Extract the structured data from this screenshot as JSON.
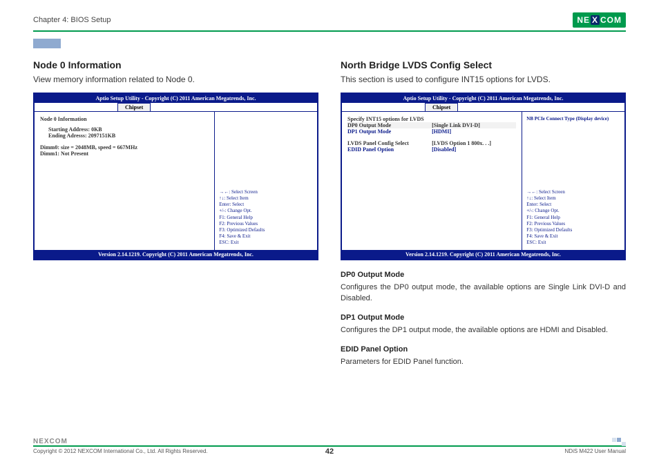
{
  "header": {
    "chapter": "Chapter 4: BIOS Setup",
    "brand_pre": "NE",
    "brand_mid": "X",
    "brand_post": "COM"
  },
  "left": {
    "heading": "Node 0 Information",
    "lead": "View memory information related to Node 0.",
    "bios": {
      "title": "Aptio Setup Utility - Copyright (C) 2011 American Megatrends, Inc.",
      "tab": "Chipset",
      "lines": {
        "l1": "Node 0 Information",
        "l2": "Starting Address: 0KB",
        "l3": "Ending Adresss: 2097151KB",
        "l4": "Dimm0: size = 2048MB, speed = 667MHz",
        "l5": "Dimm1: Not Present"
      },
      "help_top": "",
      "footer": "Version 2.14.1219. Copyright (C) 2011 American Megatrends, Inc."
    }
  },
  "right": {
    "heading": "North Bridge LVDS Config Select",
    "lead": "This section is used to configure INT15 options for LVDS.",
    "bios": {
      "title": "Aptio Setup Utility - Copyright (C) 2011 American Megatrends, Inc.",
      "tab": "Chipset",
      "rows": {
        "r0l": "Specify INT15 options for LVDS",
        "r1l": "DP0 Output Mode",
        "r1v": "[Single Link DVI-D]",
        "r2l": "DP1 Output Mode",
        "r2v": "[HDMI]",
        "r3l": "LVDS Panel Config Select",
        "r3v": "[LVDS Option 1 800x. . .]",
        "r4l": "EDID Panel Option",
        "r4v": "[Disabled]"
      },
      "help_top": "NB PCIe Connect Type (Display device)",
      "footer": "Version 2.14.1219. Copyright (C) 2011 American Megatrends, Inc."
    },
    "desc": {
      "h1": "DP0 Output Mode",
      "p1": "Configures the DP0 output mode, the available options are Single Link DVI-D and Disabled.",
      "h2": "DP1 Output Mode",
      "p2": "Configures the DP1 output mode, the available options are HDMI and Disabled.",
      "h3": "EDID Panel Option",
      "p3": "Parameters for EDID Panel function."
    }
  },
  "nav": {
    "n1": "→←: Select Screen",
    "n2": "↑↓: Select Item",
    "n3": "Enter: Select",
    "n4": "+/-: Change Opt.",
    "n5": "F1: General Help",
    "n6": "F2: Previous Values",
    "n7": "F3: Optimized Defaults",
    "n8": "F4: Save & Exit",
    "n9": "ESC: Exit"
  },
  "footer": {
    "brand": "NEXCOM",
    "copyright": "Copyright © 2012 NEXCOM International Co., Ltd. All Rights Reserved.",
    "page": "42",
    "doc": "NDiS M422 User Manual"
  }
}
